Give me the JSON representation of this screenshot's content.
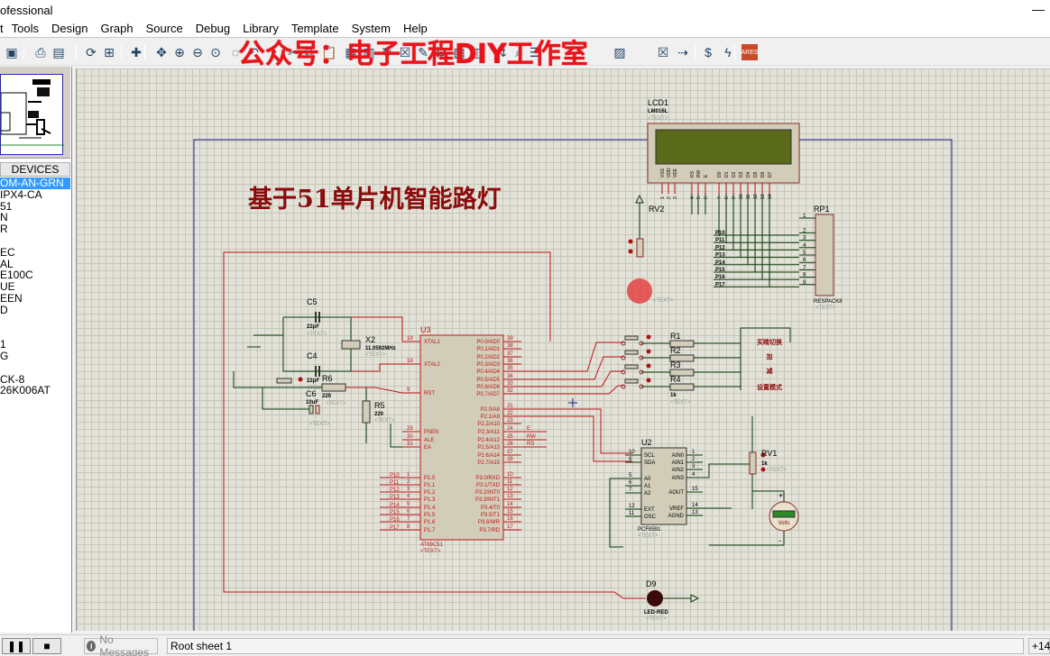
{
  "window": {
    "title": "ofessional",
    "minimize_icon": "minimize-icon"
  },
  "menu": [
    "t",
    "Tools",
    "Design",
    "Graph",
    "Source",
    "Debug",
    "Library",
    "Template",
    "System",
    "Help"
  ],
  "watermark": "公众号：电子工程DIY工作室",
  "toolbar": {
    "icons": [
      "save-icon",
      "print-icon",
      "page-icon",
      "refresh-icon",
      "grid-icon",
      "origin-icon",
      "pan-icon",
      "zoom-in-icon",
      "zoom-out-icon",
      "zoom-all-icon",
      "zoom-area-icon",
      "undo-icon",
      "redo-icon",
      "cut-icon",
      "copy-icon",
      "paste-icon",
      "block-copy-icon",
      "block-move-icon",
      "block-rotate-icon",
      "block-delete-icon",
      "pick-icon",
      "make-device-icon",
      "packaging-icon",
      "decompose-icon",
      "wire-autorouter-icon",
      "search-tag-icon",
      "property-icon",
      "new-sheet-icon",
      "remove-sheet-icon",
      "go-to-sheet-icon",
      "bom-icon",
      "netlist-icon",
      "ares-icon"
    ],
    "ares_label": "ARES"
  },
  "devices": {
    "header": "DEVICES",
    "items": [
      "OM-AN-GRN",
      "IPX4-CA",
      "51",
      "N",
      "R",
      "",
      "EC",
      "AL",
      "E100C",
      "UE",
      "EEN",
      "D",
      "",
      "",
      "1",
      "G",
      "",
      "CK-8",
      "26K006AT"
    ],
    "selected_index": 0
  },
  "schematic": {
    "title": "基于51单片机智能路灯",
    "lcd": {
      "ref": "LCD1",
      "part": "LM016L",
      "text": "<TEXT>",
      "pins": [
        "VSS",
        "VDD",
        "VEE",
        "RS",
        "RW",
        "E",
        "D0",
        "D1",
        "D2",
        "D3",
        "D4",
        "D5",
        "D6",
        "D7"
      ],
      "pin_numbers": [
        "1",
        "2",
        "3",
        "4",
        "5",
        "6",
        "7",
        "8",
        "9",
        "10",
        "11",
        "12",
        "13",
        "14"
      ],
      "net_labels": [
        "RS",
        "RW",
        "E"
      ]
    },
    "rv2": {
      "ref": "RV2",
      "text": "<TEXT>"
    },
    "rp1": {
      "ref": "RP1",
      "part": "RESPACK8",
      "text": "<TEXT>",
      "pins": [
        "1",
        "2",
        "3",
        "4",
        "5",
        "6",
        "7",
        "8",
        "9"
      ],
      "nets": [
        "P10",
        "P11",
        "P12",
        "P13",
        "P14",
        "P15",
        "P16",
        "P17"
      ]
    },
    "u3": {
      "ref": "U3",
      "part": "AT89C51",
      "text": "<TEXT>",
      "left_pins": [
        {
          "num": "19",
          "name": "XTAL1"
        },
        {
          "num": "18",
          "name": "XTAL2"
        },
        {
          "num": "9",
          "name": "RST"
        },
        {
          "num": "29",
          "name": "PSEN"
        },
        {
          "num": "30",
          "name": "ALE"
        },
        {
          "num": "31",
          "name": "EA"
        },
        {
          "num": "1",
          "name": "P1.0"
        },
        {
          "num": "2",
          "name": "P1.1"
        },
        {
          "num": "3",
          "name": "P1.2"
        },
        {
          "num": "4",
          "name": "P1.3"
        },
        {
          "num": "5",
          "name": "P1.4"
        },
        {
          "num": "6",
          "name": "P1.5"
        },
        {
          "num": "7",
          "name": "P1.6"
        },
        {
          "num": "8",
          "name": "P1.7"
        }
      ],
      "right_pins": [
        {
          "num": "39",
          "name": "P0.0/AD0"
        },
        {
          "num": "38",
          "name": "P0.1/AD1"
        },
        {
          "num": "37",
          "name": "P0.2/AD2"
        },
        {
          "num": "36",
          "name": "P0.3/AD3"
        },
        {
          "num": "35",
          "name": "P0.4/AD4"
        },
        {
          "num": "34",
          "name": "P0.5/AD5"
        },
        {
          "num": "33",
          "name": "P0.6/AD6"
        },
        {
          "num": "32",
          "name": "P0.7/AD7"
        },
        {
          "num": "21",
          "name": "P2.0/A8"
        },
        {
          "num": "22",
          "name": "P2.1/A9"
        },
        {
          "num": "23",
          "name": "P2.2/A10"
        },
        {
          "num": "24",
          "name": "P2.3/A11"
        },
        {
          "num": "25",
          "name": "P2.4/A12"
        },
        {
          "num": "26",
          "name": "P2.5/A13"
        },
        {
          "num": "27",
          "name": "P2.6/A14"
        },
        {
          "num": "28",
          "name": "P2.7/A15"
        },
        {
          "num": "10",
          "name": "P3.0/RXD"
        },
        {
          "num": "11",
          "name": "P3.1/TXD"
        },
        {
          "num": "12",
          "name": "P3.2/INT0"
        },
        {
          "num": "13",
          "name": "P3.3/INT1"
        },
        {
          "num": "14",
          "name": "P3.4/T0"
        },
        {
          "num": "15",
          "name": "P3.5/T1"
        },
        {
          "num": "16",
          "name": "P3.6/WR"
        },
        {
          "num": "17",
          "name": "P3.7/RD"
        }
      ],
      "p1_nets": [
        "P10",
        "P11",
        "P12",
        "P13",
        "P14",
        "P15",
        "P16",
        "P17"
      ],
      "p2_nets": [
        "E",
        "RW",
        "RS"
      ]
    },
    "c5": {
      "ref": "C5",
      "value": "22pF",
      "text": "<TEXT>"
    },
    "c4": {
      "ref": "C4",
      "value": "22pF",
      "text": "<TEXT>"
    },
    "c6": {
      "ref": "C6",
      "value": "10uF",
      "text": "<TEXT>"
    },
    "x2": {
      "ref": "X2",
      "value": "11.0592MHz",
      "text": "<TEXT>"
    },
    "r6": {
      "ref": "R6",
      "value": "220",
      "text": "<TEXT>"
    },
    "r5": {
      "ref": "R5",
      "value": "220",
      "text": "<TEXT>"
    },
    "resistors": [
      {
        "ref": "R1"
      },
      {
        "ref": "R2"
      },
      {
        "ref": "R3"
      },
      {
        "ref": "R4",
        "value": "1k",
        "text": "<TEXT>"
      }
    ],
    "button_labels": [
      "买睛切换",
      "加",
      "减",
      "设置模式"
    ],
    "u2": {
      "ref": "U2",
      "part": "PCF8591",
      "text": "<TEXT>",
      "left_pins": [
        {
          "num": "10",
          "name": "SCL"
        },
        {
          "num": "9",
          "name": "SDA"
        },
        {
          "num": "5",
          "name": "A0"
        },
        {
          "num": "6",
          "name": "A1"
        },
        {
          "num": "7",
          "name": "A2"
        },
        {
          "num": "12",
          "name": "EXT"
        },
        {
          "num": "11",
          "name": "OSC"
        }
      ],
      "right_pins": [
        {
          "num": "1",
          "name": "AIN0"
        },
        {
          "num": "2",
          "name": "AIN1"
        },
        {
          "num": "3",
          "name": "AIN2"
        },
        {
          "num": "4",
          "name": "AIN3"
        },
        {
          "num": "15",
          "name": "AOUT"
        },
        {
          "num": "14",
          "name": "VREF"
        },
        {
          "num": "13",
          "name": "AGND"
        }
      ]
    },
    "rv1": {
      "ref": "RV1",
      "value": "1k",
      "text": "<TEXT>"
    },
    "voltmeter": {
      "label": "Volts",
      "plus": "+",
      "minus": "-"
    },
    "d9": {
      "ref": "D9",
      "part": "LED-RED",
      "text": "<TEXT>"
    }
  },
  "status": {
    "pause_icon": "pause-icon",
    "stop_icon": "stop-icon",
    "messages": "No Messages",
    "sheet": "Root sheet 1",
    "coord": "+14"
  }
}
